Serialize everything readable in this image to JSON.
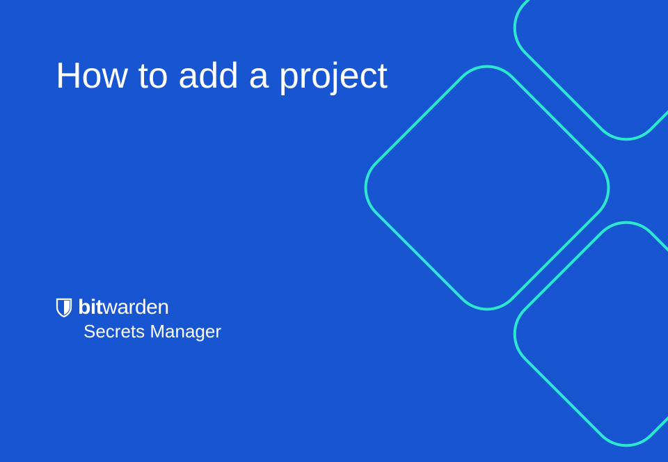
{
  "title": "How to add a project",
  "brand": {
    "prefix": "bit",
    "suffix": "warden",
    "product": "Secrets Manager"
  },
  "colors": {
    "background": "#1755d1",
    "text": "#ffffff",
    "accent": "#2de8cf"
  }
}
